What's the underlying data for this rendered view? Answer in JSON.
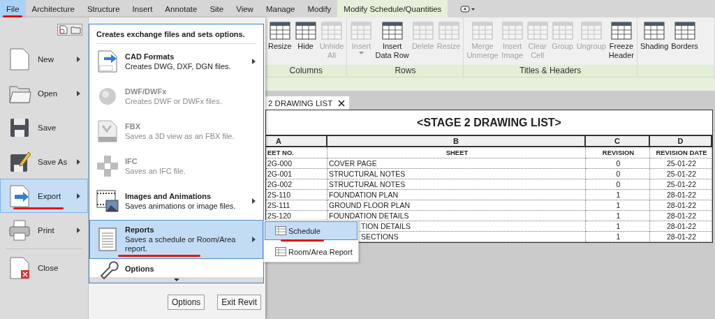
{
  "menu_tabs": [
    {
      "label": "File",
      "kind": "file",
      "selected": false,
      "marked": true
    },
    {
      "label": "Architecture",
      "kind": "tab",
      "selected": false,
      "marked": false
    },
    {
      "label": "Structure",
      "kind": "tab",
      "selected": false,
      "marked": false
    },
    {
      "label": "Insert",
      "kind": "tab",
      "selected": false,
      "marked": false
    },
    {
      "label": "Annotate",
      "kind": "tab",
      "selected": false,
      "marked": false
    },
    {
      "label": "Site",
      "kind": "tab",
      "selected": false,
      "marked": false
    },
    {
      "label": "View",
      "kind": "tab",
      "selected": false,
      "marked": false
    },
    {
      "label": "Manage",
      "kind": "tab",
      "selected": false,
      "marked": false
    },
    {
      "label": "Modify",
      "kind": "tab",
      "selected": false,
      "marked": false
    },
    {
      "label": "Modify Schedule/Quantities",
      "kind": "tab",
      "selected": true,
      "marked": false
    }
  ],
  "ribbon": {
    "groups": [
      {
        "label": "Columns",
        "buttons": [
          {
            "label": "Resize",
            "disabled": false
          },
          {
            "label": "Hide",
            "disabled": false
          },
          {
            "label": "Unhide\nAll",
            "disabled": true
          }
        ]
      },
      {
        "label": "Rows",
        "buttons": [
          {
            "label": "Insert",
            "disabled": true,
            "dropdown": true
          },
          {
            "label": "Insert\nData Row",
            "disabled": false
          },
          {
            "label": "Delete",
            "disabled": true
          },
          {
            "label": "Resize",
            "disabled": true
          }
        ]
      },
      {
        "label": "Titles & Headers",
        "buttons": [
          {
            "label": "Merge\nUnmerge",
            "disabled": true
          },
          {
            "label": "Insert\nImage",
            "disabled": true
          },
          {
            "label": "Clear\nCell",
            "disabled": true
          },
          {
            "label": "Group",
            "disabled": true
          },
          {
            "label": "Ungroup",
            "disabled": true
          },
          {
            "label": "Freeze\nHeader",
            "disabled": false
          }
        ]
      },
      {
        "buttons": [
          {
            "label": "Shading",
            "disabled": false
          },
          {
            "label": "Borders",
            "disabled": false
          }
        ]
      }
    ]
  },
  "view_tab": {
    "label": "2 DRAWING LIST"
  },
  "schedule": {
    "title": "<STAGE 2 DRAWING LIST>",
    "column_letters": [
      "A",
      "B",
      "C",
      "D"
    ],
    "headers": [
      "EET NO.",
      "SHEET",
      "REVISION",
      "REVISION DATE"
    ],
    "rows": [
      {
        "sheet_no": "2G-000",
        "sheet": "COVER PAGE",
        "revision": "0",
        "date": "25-01-22"
      },
      {
        "sheet_no": "2G-001",
        "sheet": "STRUCTURAL NOTES",
        "revision": "0",
        "date": "25-01-22"
      },
      {
        "sheet_no": "2G-002",
        "sheet": "STRUCTURAL NOTES",
        "revision": "0",
        "date": "25-01-22"
      },
      {
        "sheet_no": "2S-110",
        "sheet": "FOUNDATION PLAN",
        "revision": "1",
        "date": "28-01-22"
      },
      {
        "sheet_no": "2S-111",
        "sheet": "GROUND FLOOR PLAN",
        "revision": "1",
        "date": "28-01-22"
      },
      {
        "sheet_no": "2S-120",
        "sheet": "FOUNDATION DETAILS",
        "revision": "1",
        "date": "28-01-22"
      },
      {
        "sheet": "TION DETAILS",
        "revision": "1",
        "date": "28-01-22"
      },
      {
        "sheet": "SECTIONS",
        "revision": "1",
        "date": "28-01-22"
      }
    ]
  },
  "file_menu": {
    "commands": [
      {
        "label": "New",
        "arrow": true,
        "selected": false,
        "marked": false
      },
      {
        "label": "Open",
        "arrow": true,
        "selected": false,
        "marked": false
      },
      {
        "label": "Save",
        "arrow": false,
        "selected": false,
        "marked": false
      },
      {
        "label": "Save As",
        "arrow": true,
        "selected": false,
        "marked": false
      },
      {
        "label": "Export",
        "arrow": true,
        "selected": true,
        "marked": true
      },
      {
        "label": "Print",
        "arrow": true,
        "selected": false,
        "marked": false
      },
      {
        "label": "Close",
        "arrow": false,
        "selected": false,
        "marked": false
      }
    ],
    "panel": {
      "heading": "Creates exchange files and sets options.",
      "items": [
        {
          "title": "CAD Formats",
          "description": "Creates DWG, DXF, DGN files.",
          "disabled": false,
          "arrow": true,
          "selected": false,
          "marked": false
        },
        {
          "title": "DWF/DWFx",
          "description": "Creates DWF or DWFx files.",
          "disabled": true,
          "arrow": false,
          "selected": false,
          "marked": false
        },
        {
          "title": "FBX",
          "description": "Saves a 3D view as an FBX file.",
          "disabled": true,
          "arrow": false,
          "selected": false,
          "marked": false
        },
        {
          "title": "IFC",
          "description": "Saves an IFC file.",
          "disabled": true,
          "arrow": false,
          "selected": false,
          "marked": false
        },
        {
          "title": "Images and Animations",
          "description": "Saves animations or image files.",
          "disabled": false,
          "arrow": true,
          "selected": false,
          "marked": false
        },
        {
          "title": "Reports",
          "description": "Saves a schedule or Room/Area report.",
          "disabled": false,
          "arrow": true,
          "selected": true,
          "marked": true
        },
        {
          "title": "Options",
          "disabled": false,
          "arrow": false,
          "selected": false,
          "marked": false
        }
      ]
    },
    "buttons": [
      "Options",
      "Exit Revit"
    ]
  },
  "submenu": [
    {
      "label": "Schedule",
      "selected": true,
      "marked": true
    },
    {
      "label": "Room/Area Report",
      "selected": false,
      "marked": false
    }
  ]
}
